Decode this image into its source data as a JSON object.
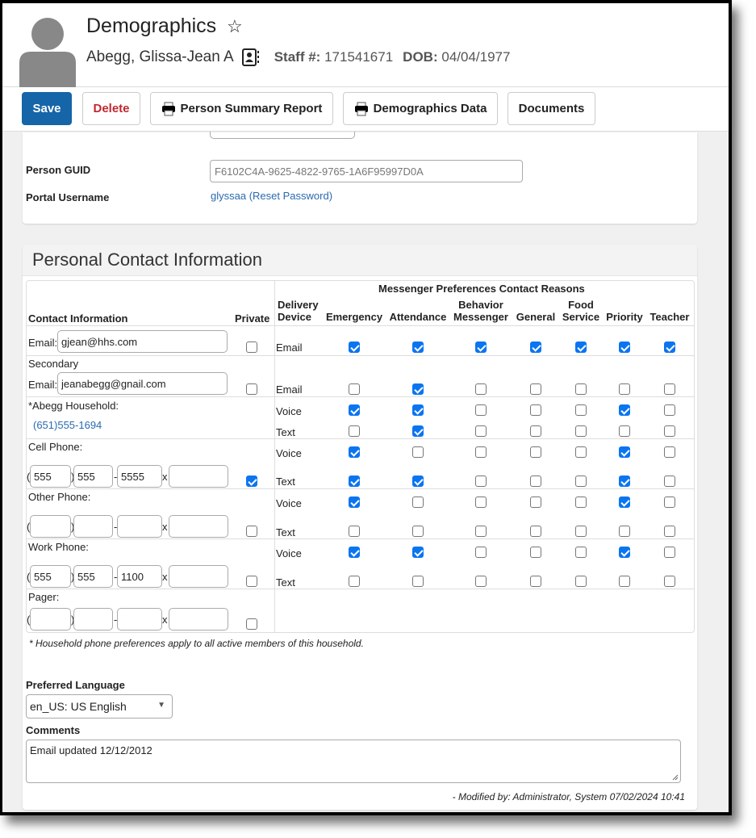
{
  "header": {
    "title": "Demographics",
    "favorite_icon": "star-outline-icon",
    "person_name": "Abegg, Glissa-Jean A",
    "contact_card_icon": "contact-card-icon",
    "staff_label": "Staff #:",
    "staff_number": "171541671",
    "dob_label": "DOB:",
    "dob": "04/04/1977"
  },
  "toolbar": {
    "save": "Save",
    "delete": "Delete",
    "person_summary_report": "Person Summary Report",
    "demographics_data": "Demographics Data",
    "documents": "Documents"
  },
  "identity": {
    "person_guid_label": "Person GUID",
    "person_guid": "F6102C4A-9625-4822-9765-1A6F95997D0A",
    "portal_username_label": "Portal Username",
    "portal_username": "glyssaa",
    "reset_password": "Reset Password"
  },
  "contact": {
    "section_title": "Personal Contact Information",
    "headers": {
      "contact_information": "Contact Information",
      "private": "Private",
      "delivery_device_1": "Delivery",
      "delivery_device_2": "Device",
      "messenger_group": "Messenger Preferences Contact Reasons",
      "reasons": [
        {
          "line1": "",
          "line2": "Emergency"
        },
        {
          "line1": "",
          "line2": "Attendance"
        },
        {
          "line1": "Behavior",
          "line2": "Messenger"
        },
        {
          "line1": "",
          "line2": "General"
        },
        {
          "line1": "Food",
          "line2": "Service"
        },
        {
          "line1": "",
          "line2": "Priority"
        },
        {
          "line1": "",
          "line2": "Teacher"
        }
      ]
    },
    "email": {
      "label": "Email:",
      "value": "gjean@hhs.com",
      "private": false,
      "device": "Email",
      "prefs": [
        true,
        true,
        true,
        true,
        true,
        true,
        true
      ]
    },
    "secondary_email": {
      "label_line1": "Secondary",
      "label": "Email:",
      "value": "jeanabegg@gnail.com",
      "private": false,
      "device": "Email",
      "prefs": [
        false,
        true,
        false,
        false,
        false,
        false,
        false
      ]
    },
    "household": {
      "label": "*Abegg Household:",
      "phone": "(651)555-1694",
      "voice_label": "Voice",
      "text_label": "Text",
      "voice_prefs": [
        true,
        true,
        false,
        false,
        false,
        true,
        false
      ],
      "text_prefs": [
        false,
        true,
        false,
        false,
        false,
        false,
        false
      ]
    },
    "cell_phone": {
      "label": "Cell Phone:",
      "area": "555",
      "prefix": "555",
      "line": "5555",
      "ext": "",
      "private": true,
      "voice_label": "Voice",
      "text_label": "Text",
      "voice_prefs": [
        true,
        false,
        false,
        false,
        false,
        true,
        false
      ],
      "text_prefs": [
        true,
        true,
        false,
        false,
        false,
        true,
        false
      ]
    },
    "other_phone": {
      "label": "Other Phone:",
      "area": "",
      "prefix": "",
      "line": "",
      "ext": "",
      "private": false,
      "voice_label": "Voice",
      "text_label": "Text",
      "voice_prefs": [
        true,
        false,
        false,
        false,
        false,
        true,
        false
      ],
      "text_prefs": [
        false,
        false,
        false,
        false,
        false,
        false,
        false
      ]
    },
    "work_phone": {
      "label": "Work Phone:",
      "area": "555",
      "prefix": "555",
      "line": "1100",
      "ext": "",
      "private": false,
      "voice_label": "Voice",
      "text_label": "Text",
      "voice_prefs": [
        true,
        true,
        false,
        false,
        false,
        true,
        false
      ],
      "text_prefs": [
        false,
        false,
        false,
        false,
        false,
        false,
        false
      ]
    },
    "pager": {
      "label": "Pager:",
      "area": "",
      "prefix": "",
      "line": "",
      "ext": "",
      "private": false
    },
    "phone_symbols": {
      "open": "(",
      "close": ")",
      "dash": "-",
      "ext": "x"
    },
    "footnote": "* Household phone preferences apply to all active members of this household.",
    "preferred_language_label": "Preferred Language",
    "preferred_language": "en_US: US English",
    "comments_label": "Comments",
    "comments": "Email updated 12/12/2012",
    "modified_by": "- Modified by: Administrator, System 07/02/2024 10:41"
  },
  "colors": {
    "save_button": "#1565a8",
    "delete_text": "#c0282f",
    "link": "#2a6ab0",
    "checkbox_checked": "#0b75f0"
  }
}
